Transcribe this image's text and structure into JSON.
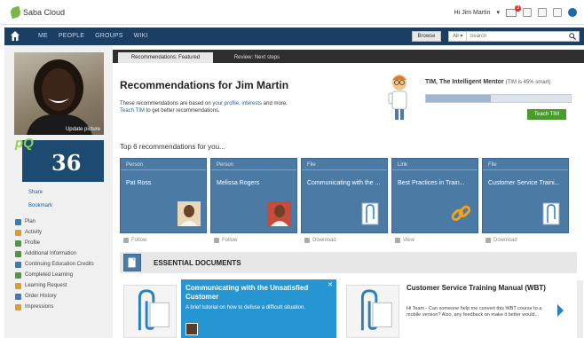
{
  "app": {
    "name": "Saba Cloud"
  },
  "user_menu": {
    "greeting": "Hi Jim Martin",
    "mail_count": "3"
  },
  "nav": {
    "items": [
      "ME",
      "PEOPLE",
      "GROUPS",
      "WIKI"
    ],
    "browse_label": "Browse",
    "search_scope": "All",
    "search_placeholder": "Search"
  },
  "sidebar": {
    "update_picture": "Update picture",
    "points_logo": "pQ",
    "points": "36",
    "share": "Share",
    "bookmark": "Bookmark",
    "menu": [
      {
        "label": "Plan",
        "color": "#3a7bbf"
      },
      {
        "label": "Activity",
        "color": "#e49a2a"
      },
      {
        "label": "Profile",
        "color": "#4a9a3a"
      },
      {
        "label": "Additional Information",
        "color": "#4a9a3a"
      },
      {
        "label": "Continuing Education Credits",
        "color": "#3a7bbf"
      },
      {
        "label": "Completed Learning",
        "color": "#4a9a3a"
      },
      {
        "label": "Learning Request",
        "color": "#e49a2a"
      },
      {
        "label": "Order History",
        "color": "#3a7bbf"
      },
      {
        "label": "Impressions",
        "color": "#e49a2a"
      }
    ]
  },
  "tabs": {
    "active": "Recommendations: Featured",
    "inactive": "Review: Next steps"
  },
  "recommendations": {
    "title": "Recommendations for Jim Martin",
    "desc_pre": "These recommendations are based on ",
    "desc_link1": "your profile, interests",
    "desc_mid": " and more.",
    "desc_link2": "Teach TIM",
    "desc_post": " to get better recommendations."
  },
  "mentor": {
    "title": "TIM, The Intelligent Mentor",
    "level": "(TIM is 45% smart)",
    "progress": 0.45,
    "teach_label": "Teach TIM"
  },
  "top_heading": "Top 6 recommendations for you...",
  "cards": [
    {
      "type": "Person",
      "title": "Pat Ross",
      "thumb": "person",
      "action": "Follow"
    },
    {
      "type": "Person",
      "title": "Melissa Rogers",
      "thumb": "person",
      "action": "Follow"
    },
    {
      "type": "File",
      "title": "Communicating with the ...",
      "thumb": "file",
      "action": "Download"
    },
    {
      "type": "Link",
      "title": "Best Practices in Train...",
      "thumb": "link",
      "action": "View"
    },
    {
      "type": "File",
      "title": "Customer Service Traini...",
      "thumb": "file",
      "action": "Download"
    }
  ],
  "essential": {
    "title": "ESSENTIAL DOCUMENTS",
    "doc1_title": "Communicating with the Unsatisfied Customer",
    "doc1_desc": "A brief tutorial on how to defuse a difficult situation.",
    "doc2_title": "Customer Service Training Manual (WBT)",
    "doc2_desc": "Hi Team - Can someone help me convert this WBT course to a mobile version? Also, any feedback on make it better would..."
  },
  "colors": {
    "nav_bg": "#1a3e64",
    "card_bg": "#4b7aa5",
    "accent_green": "#4b9a2c",
    "doc_blue": "#2596d1"
  }
}
